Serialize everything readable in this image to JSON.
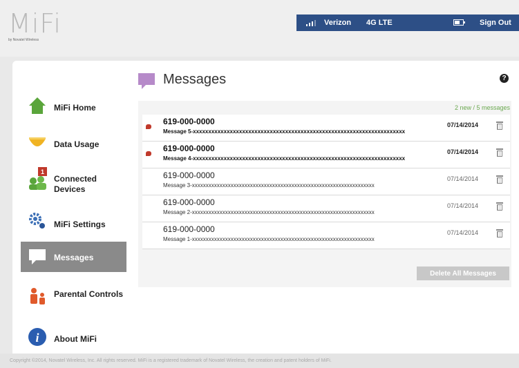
{
  "brand": {
    "logo": "MiFi",
    "tagline": "by Novatel Wireless"
  },
  "status": {
    "carrier": "Verizon",
    "network": "4G LTE",
    "signout": "Sign Out"
  },
  "nav": [
    {
      "label": "MiFi Home"
    },
    {
      "label": "Data Usage"
    },
    {
      "label": "Connected Devices",
      "badge": "1"
    },
    {
      "label": "MiFi Settings"
    },
    {
      "label": "Messages",
      "active": true
    },
    {
      "label": "Parental Controls"
    },
    {
      "label": "About MiFi"
    }
  ],
  "page": {
    "title": "Messages",
    "help": "?"
  },
  "messages": {
    "count_text": "2 new / 5 messages",
    "items": [
      {
        "phone": "619-000-0000",
        "body": "Message 5-xxxxxxxxxxxxxxxxxxxxxxxxxxxxxxxxxxxxxxxxxxxxxxxxxxxxxxxxxxxxxxxxxxxxx",
        "date": "07/14/2014",
        "unread": true
      },
      {
        "phone": "619-000-0000",
        "body": "Message 4-xxxxxxxxxxxxxxxxxxxxxxxxxxxxxxxxxxxxxxxxxxxxxxxxxxxxxxxxxxxxxxxxxxxxx",
        "date": "07/14/2014",
        "unread": true
      },
      {
        "phone": "619-000-0000",
        "body": "Message 3-xxxxxxxxxxxxxxxxxxxxxxxxxxxxxxxxxxxxxxxxxxxxxxxxxxxxxxxxxxxxxxxxxx",
        "date": "07/14/2014",
        "unread": false
      },
      {
        "phone": "619-000-0000",
        "body": "Message 2-xxxxxxxxxxxxxxxxxxxxxxxxxxxxxxxxxxxxxxxxxxxxxxxxxxxxxxxxxxxxxxxxxx",
        "date": "07/14/2014",
        "unread": false
      },
      {
        "phone": "619-000-0000",
        "body": "Message 1-xxxxxxxxxxxxxxxxxxxxxxxxxxxxxxxxxxxxxxxxxxxxxxxxxxxxxxxxxxxxxxxxxx",
        "date": "07/14/2014",
        "unread": false
      }
    ],
    "delete_all": "Delete All Messages"
  },
  "footer": {
    "text": "Copyright ©2014, Novatel Wireless, Inc. All rights reserved. MiFi is a registered trademark of Novatel Wireless, the creation and patent holders of MiFi."
  },
  "colors": {
    "status_bar": "#2d4f86",
    "active_nav": "#8a8a8a",
    "unread_dot": "#c0392b",
    "count_text": "#6aa84f"
  }
}
